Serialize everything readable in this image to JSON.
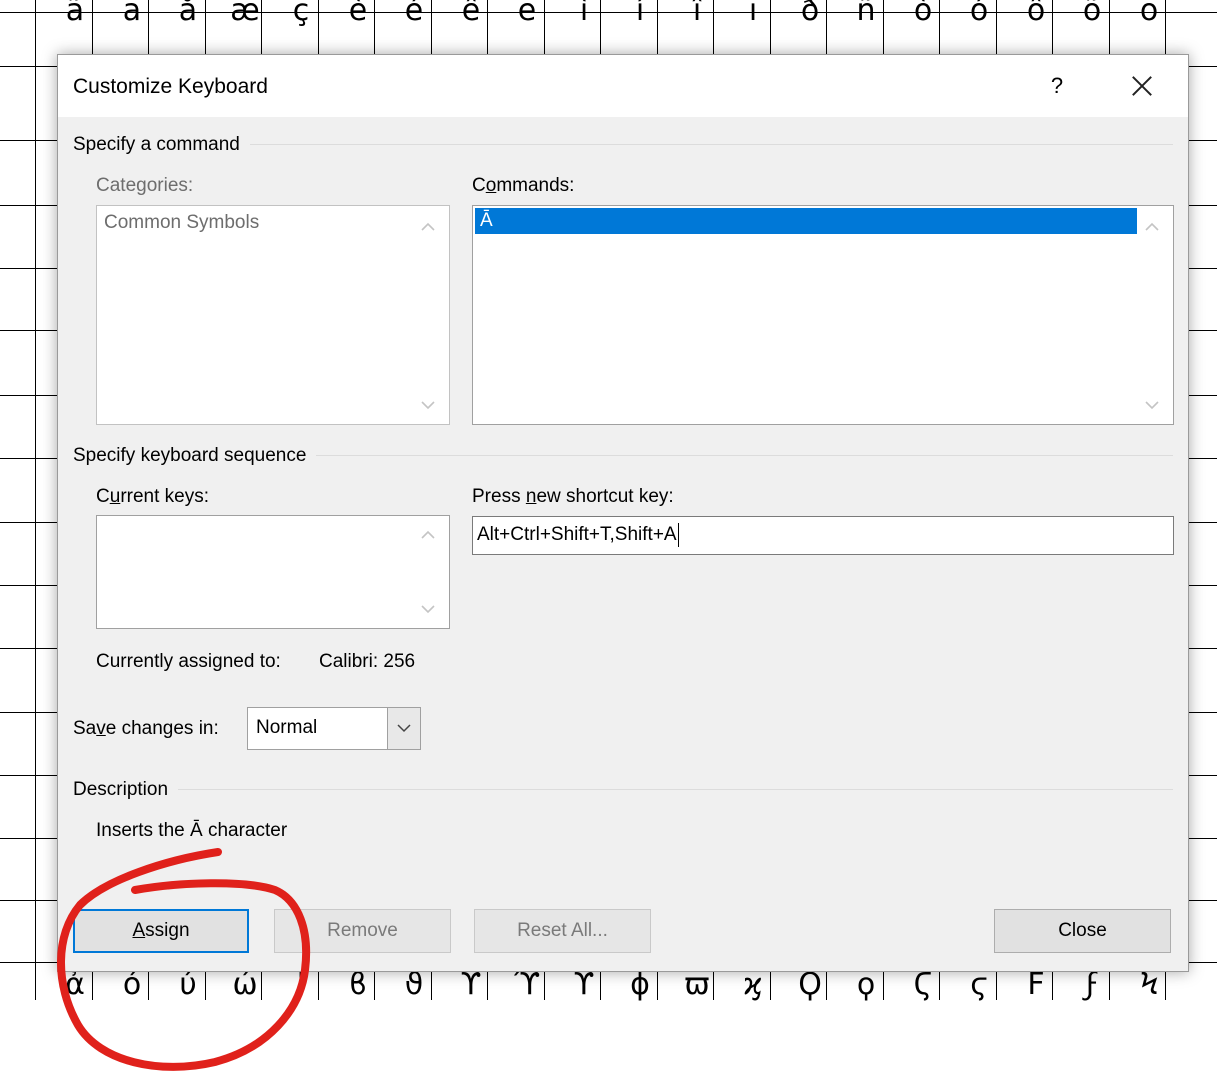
{
  "background": {
    "top_row": [
      "ã",
      "ä",
      "å",
      "æ",
      "ç",
      "è",
      "é",
      "ê",
      "ë",
      "ì",
      "í",
      "î",
      "ï",
      "ð",
      "ñ",
      "ò",
      "ó",
      "ô",
      "õ",
      "ö"
    ],
    "bottom_row": [
      "ἀ",
      "ό",
      "ύ",
      "ώ",
      "Ι",
      "ϐ",
      "ϑ",
      "ϒ",
      "ϓ",
      "ϔ",
      "ϕ",
      "ϖ",
      "ϗ",
      "Ϙ",
      "ϙ",
      "Ϛ",
      "ϛ",
      "Ϝ",
      "ϝ",
      "Ϟ"
    ]
  },
  "dialog": {
    "title": "Customize Keyboard",
    "help": "?",
    "specify_command": {
      "heading": "Specify a command",
      "categories_label": "Categories:",
      "categories": [
        "Common Symbols"
      ],
      "commands_label_pre": "C",
      "commands_label_u": "o",
      "commands_label_post": "mmands:",
      "commands": [
        "Ā"
      ]
    },
    "keyboard_sequence": {
      "heading": "Specify keyboard sequence",
      "current_keys_label_pre": "C",
      "current_keys_label_u": "u",
      "current_keys_label_post": "rrent keys:",
      "new_key_label_pre": "Press ",
      "new_key_label_u": "n",
      "new_key_label_post": "ew shortcut key:",
      "new_key_value": "Alt+Ctrl+Shift+T,Shift+A",
      "assigned_label": "Currently assigned to:",
      "assigned_value": "Calibri: 256"
    },
    "save_changes": {
      "label_pre": "Sa",
      "label_u": "v",
      "label_post": "e changes in:",
      "value": "Normal"
    },
    "description": {
      "heading": "Description",
      "text": "Inserts the Ā character"
    },
    "buttons": {
      "assign_u": "A",
      "assign_post": "ssign",
      "remove": "Remove",
      "reset_all": "Reset All...",
      "close": "Close"
    }
  },
  "colors": {
    "selection": "#0078d7",
    "annotation": "#e0211b"
  }
}
